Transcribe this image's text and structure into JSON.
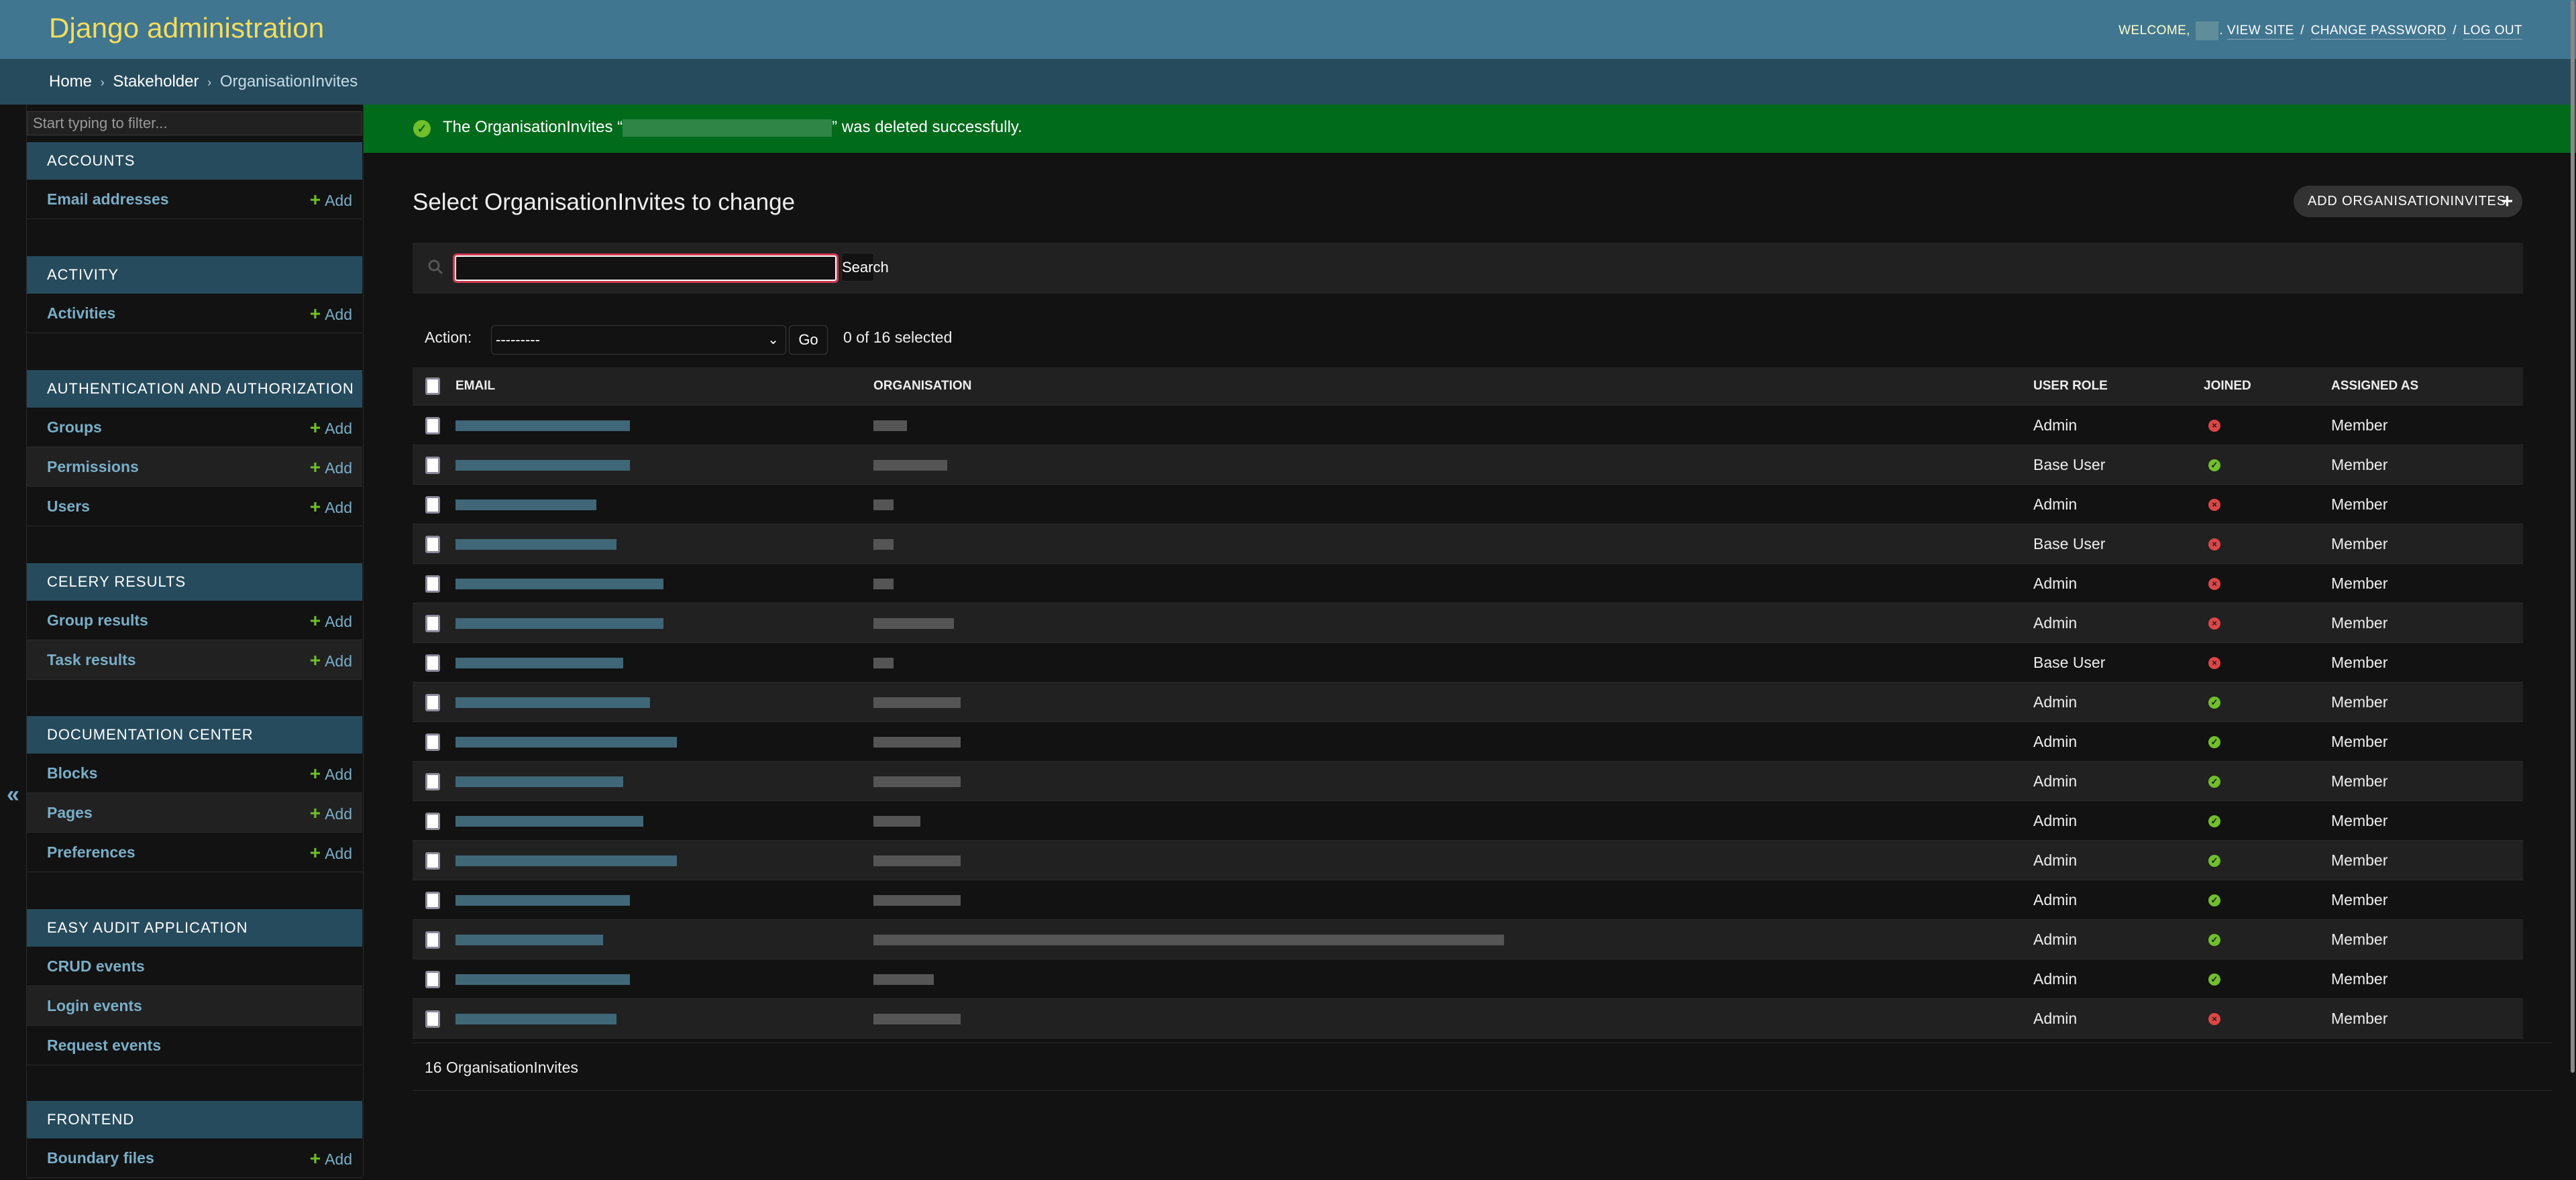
{
  "header": {
    "branding": "Django administration",
    "welcome": "WELCOME,",
    "username_redacted": true,
    "links": [
      "VIEW SITE",
      "CHANGE PASSWORD",
      "LOG OUT"
    ],
    "separator": "/"
  },
  "breadcrumbs": {
    "items": [
      "Home",
      "Stakeholder",
      "OrganisationInvites"
    ],
    "separator": "›"
  },
  "sidebar": {
    "filter_placeholder": "Start typing to filter...",
    "collapse_icon": "«",
    "add_label": "Add",
    "modules": [
      {
        "caption": "Accounts",
        "models": [
          {
            "name": "Email addresses",
            "add": true
          }
        ]
      },
      {
        "caption": "Activity",
        "models": [
          {
            "name": "Activities",
            "add": true
          }
        ]
      },
      {
        "caption": "Authentication and Authorization",
        "models": [
          {
            "name": "Groups",
            "add": true
          },
          {
            "name": "Permissions",
            "add": true
          },
          {
            "name": "Users",
            "add": true
          }
        ]
      },
      {
        "caption": "Celery Results",
        "models": [
          {
            "name": "Group results",
            "add": true
          },
          {
            "name": "Task results",
            "add": true
          }
        ]
      },
      {
        "caption": "Documentation Center",
        "models": [
          {
            "name": "Blocks",
            "add": true
          },
          {
            "name": "Pages",
            "add": true
          },
          {
            "name": "Preferences",
            "add": true
          }
        ]
      },
      {
        "caption": "Easy Audit Application",
        "models": [
          {
            "name": "CRUD events",
            "add": false
          },
          {
            "name": "Login events",
            "add": false
          },
          {
            "name": "Request events",
            "add": false
          }
        ]
      },
      {
        "caption": "Frontend",
        "models": [
          {
            "name": "Boundary files",
            "add": true
          }
        ]
      }
    ]
  },
  "message": {
    "prefix": "The OrganisationInvites “",
    "suffix": "” was deleted successfully.",
    "type": "success",
    "color": "#006b1b"
  },
  "main": {
    "title": "Select OrganisationInvites to change",
    "add_button": "ADD ORGANISATIONINVITES",
    "search": {
      "value": "",
      "button": "Search"
    },
    "actions": {
      "label": "Action:",
      "selected": "---------",
      "go": "Go",
      "selection_count": "0 of 16 selected"
    },
    "table": {
      "columns": [
        "Email",
        "Organisation",
        "User role",
        "Joined",
        "Assigned as"
      ],
      "rows": [
        {
          "email": "[redacted]",
          "organisation": "[redacted]",
          "user_role": "Admin",
          "joined": false,
          "assigned_as": "Member"
        },
        {
          "email": "[redacted]",
          "organisation": "[redacted]",
          "user_role": "Base User",
          "joined": true,
          "assigned_as": "Member"
        },
        {
          "email": "[redacted]",
          "organisation": "[redacted]",
          "user_role": "Admin",
          "joined": false,
          "assigned_as": "Member"
        },
        {
          "email": "[redacted]",
          "organisation": "[redacted]",
          "user_role": "Base User",
          "joined": false,
          "assigned_as": "Member"
        },
        {
          "email": "[redacted]",
          "organisation": "[redacted]",
          "user_role": "Admin",
          "joined": false,
          "assigned_as": "Member"
        },
        {
          "email": "[redacted]",
          "organisation": "[redacted]",
          "user_role": "Admin",
          "joined": false,
          "assigned_as": "Member"
        },
        {
          "email": "[redacted]",
          "organisation": "[redacted]",
          "user_role": "Base User",
          "joined": false,
          "assigned_as": "Member"
        },
        {
          "email": "[redacted]",
          "organisation": "[redacted]",
          "user_role": "Admin",
          "joined": true,
          "assigned_as": "Member"
        },
        {
          "email": "[redacted]",
          "organisation": "[redacted]",
          "user_role": "Admin",
          "joined": true,
          "assigned_as": "Member"
        },
        {
          "email": "[redacted]",
          "organisation": "[redacted]",
          "user_role": "Admin",
          "joined": true,
          "assigned_as": "Member"
        },
        {
          "email": "[redacted]",
          "organisation": "[redacted]",
          "user_role": "Admin",
          "joined": true,
          "assigned_as": "Member"
        },
        {
          "email": "[redacted]",
          "organisation": "[redacted]",
          "user_role": "Admin",
          "joined": true,
          "assigned_as": "Member"
        },
        {
          "email": "[redacted]",
          "organisation": "[redacted]",
          "user_role": "Admin",
          "joined": true,
          "assigned_as": "Member"
        },
        {
          "email": "[redacted]",
          "organisation": "[redacted]",
          "user_role": "Admin",
          "joined": true,
          "assigned_as": "Member"
        },
        {
          "email": "[redacted]",
          "organisation": "[redacted]",
          "user_role": "Admin",
          "joined": true,
          "assigned_as": "Member"
        },
        {
          "email": "[redacted]",
          "organisation": "[redacted]",
          "user_role": "Admin",
          "joined": false,
          "assigned_as": "Member"
        }
      ]
    },
    "paginator": "16 OrganisationInvites"
  },
  "colors": {
    "header_bg": "#417690",
    "branding": "#f5dd5d",
    "breadcrumbs_bg": "#264b5d",
    "link": "#79aec8",
    "add_plus": "#70bf2b",
    "joined_yes": "#70bf2b",
    "joined_no": "#dd4646",
    "search_focus": "#d1384f"
  }
}
